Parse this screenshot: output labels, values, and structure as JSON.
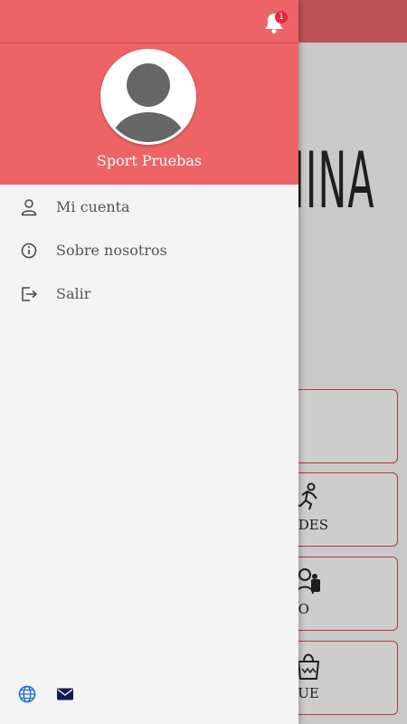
{
  "user": {
    "name": "Sport Pruebas"
  },
  "notifications": {
    "count": "1"
  },
  "menu": [
    {
      "label": "Mi cuenta",
      "icon": "user-icon"
    },
    {
      "label": "Sobre nosotros",
      "icon": "info-icon"
    },
    {
      "label": "Salir",
      "icon": "logout-icon"
    }
  ],
  "footer": [
    {
      "icon": "globe-icon"
    },
    {
      "icon": "mail-icon"
    }
  ],
  "background": {
    "logo_text": "MINA",
    "cards": [
      {
        "label": ""
      },
      {
        "label": "IDADES",
        "icon": "running-icon"
      },
      {
        "label": "UIPO",
        "icon": "team-icon"
      },
      {
        "label": "TIQUE",
        "icon": "shopping-bag-icon"
      }
    ]
  },
  "colors": {
    "header": "#ee6466",
    "topbar_dim": "#bb5356",
    "badge": "#e5283b",
    "accent_blue": "#1f6fd1"
  }
}
